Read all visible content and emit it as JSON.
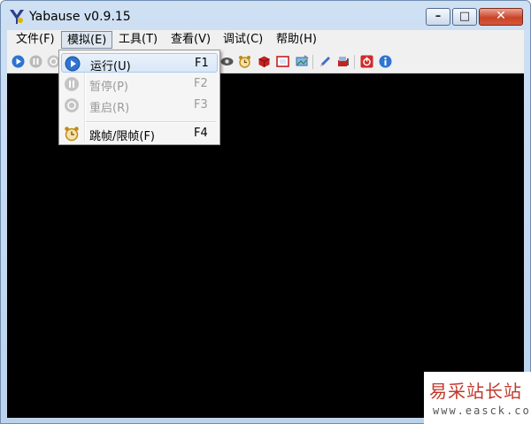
{
  "window": {
    "title": "Yabause v0.9.15",
    "buttons": {
      "min": "–",
      "max": "□",
      "close": "✕"
    }
  },
  "menubar": [
    {
      "label": "文件(F)"
    },
    {
      "label": "模拟(E)"
    },
    {
      "label": "工具(T)"
    },
    {
      "label": "查看(V)"
    },
    {
      "label": "调试(C)"
    },
    {
      "label": "帮助(H)"
    }
  ],
  "toolbar": {
    "icons": [
      "run-icon",
      "pause-icon",
      "reset-icon",
      "eye-icon",
      "alarm-clock-icon",
      "red-cube-icon",
      "fullscreen-icon",
      "screenshot-icon",
      "pencil-icon",
      "brush-icon",
      "power-icon",
      "info-icon"
    ]
  },
  "emulation_menu": {
    "items": [
      {
        "label": "运行(U)",
        "shortcut": "F1",
        "enabled": true,
        "icon": "run-icon"
      },
      {
        "label": "暂停(P)",
        "shortcut": "F2",
        "enabled": false,
        "icon": "pause-icon"
      },
      {
        "label": "重启(R)",
        "shortcut": "F3",
        "enabled": false,
        "icon": "reset-icon"
      },
      {
        "label": "跳帧/限帧(F)",
        "shortcut": "F4",
        "enabled": true,
        "icon": "alarm-clock-icon"
      }
    ]
  },
  "watermark": {
    "text": "易采站长站",
    "url": "www.easck.com"
  },
  "colors": {
    "close_button": "#c9442a",
    "screen": "#000000",
    "accent": "#3a7fd5"
  }
}
